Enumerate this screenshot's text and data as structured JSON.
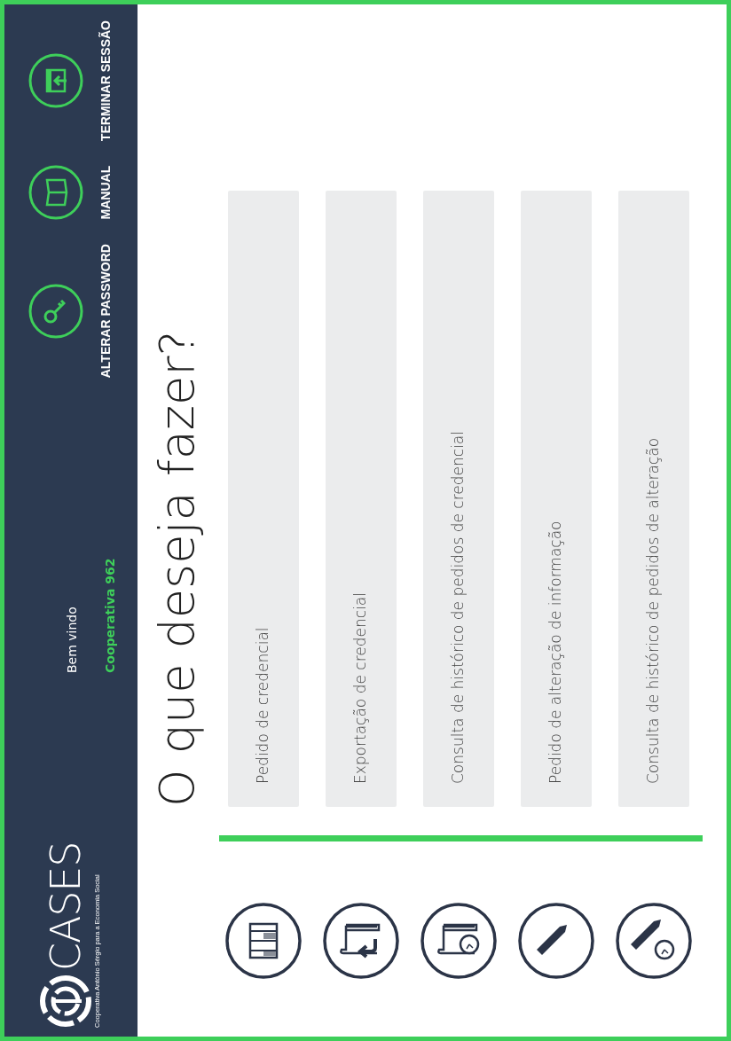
{
  "header": {
    "logo": {
      "name": "CASES",
      "tagline": "Cooperativa António Sérgio para a Economia Social"
    },
    "welcome": "Bem vindo",
    "user": "Cooperativa 962",
    "actions": [
      {
        "kind": "key",
        "label": "ALTERAR PASSWORD"
      },
      {
        "kind": "book",
        "label": "MANUAL"
      },
      {
        "kind": "logout",
        "label": "TERMINAR SESSÃO"
      }
    ]
  },
  "title": "O que deseja fazer?",
  "options": [
    {
      "kind": "columns",
      "label": "Pedido de credencial"
    },
    {
      "kind": "export",
      "label": "Exportação de credencial"
    },
    {
      "kind": "history",
      "label": "Consulta de histórico de pedidos de credencial"
    },
    {
      "kind": "edit",
      "label": "Pedido de alteração de informação"
    },
    {
      "kind": "edit-history",
      "label": "Consulta de histórico de pedidos de alteração"
    }
  ]
}
